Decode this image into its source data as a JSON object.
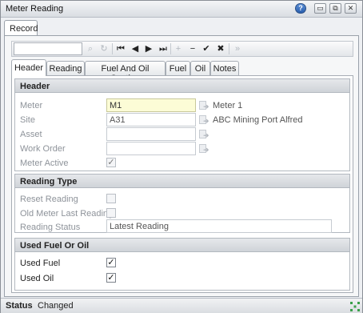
{
  "window": {
    "title": "Meter Reading",
    "help_glyph": "?",
    "minimize_glyph": "▭",
    "restore_glyph": "⧉",
    "close_glyph": "✕"
  },
  "outer_tab": {
    "label": "Record"
  },
  "toolbar": {
    "search_value": "",
    "search_placeholder": "",
    "icons": [
      "search-icon",
      "refresh-icon",
      "first-record-icon",
      "previous-record-icon",
      "next-record-icon",
      "last-record-icon",
      "add-icon",
      "remove-icon",
      "save-icon",
      "cancel-icon",
      "more-icon"
    ],
    "glyphs": {
      "search": "⌕",
      "refresh": "↻",
      "first": "⏮",
      "prev": "◀",
      "next": "▶",
      "last": "⏭",
      "add": "+",
      "remove": "−",
      "save": "✔",
      "cancel": "✖",
      "more": "»"
    }
  },
  "tabs": [
    {
      "label": "Header",
      "active": true
    },
    {
      "label": "Reading"
    },
    {
      "label": "Fuel And Oil Costing"
    },
    {
      "label": "Fuel"
    },
    {
      "label": "Oil"
    },
    {
      "label": "Notes"
    }
  ],
  "header_section": {
    "title": "Header",
    "meter_label": "Meter",
    "meter_value": "M1",
    "meter_desc": "Meter 1",
    "site_label": "Site",
    "site_value": "A31",
    "site_desc": "ABC Mining Port Alfred",
    "asset_label": "Asset",
    "asset_value": "",
    "work_order_label": "Work Order",
    "work_order_value": "",
    "meter_active_label": "Meter Active",
    "meter_active_checked": true
  },
  "reading_type_section": {
    "title": "Reading Type",
    "reset_reading_label": "Reset Reading",
    "reset_reading_checked": false,
    "old_meter_label": "Old Meter Last Reading",
    "old_meter_checked": false,
    "reading_status_label": "Reading Status",
    "reading_status_value": "Latest Reading"
  },
  "fuel_oil_section": {
    "title": "Used Fuel Or Oil",
    "used_fuel_label": "Used Fuel",
    "used_fuel_checked": true,
    "used_oil_label": "Used Oil",
    "used_oil_checked": true
  },
  "checkmark_glyph": "✓",
  "status": {
    "label": "Status",
    "value": "Changed"
  },
  "colors": {
    "required_field": "#fcfcd6",
    "section_header": "#d9dce0"
  }
}
